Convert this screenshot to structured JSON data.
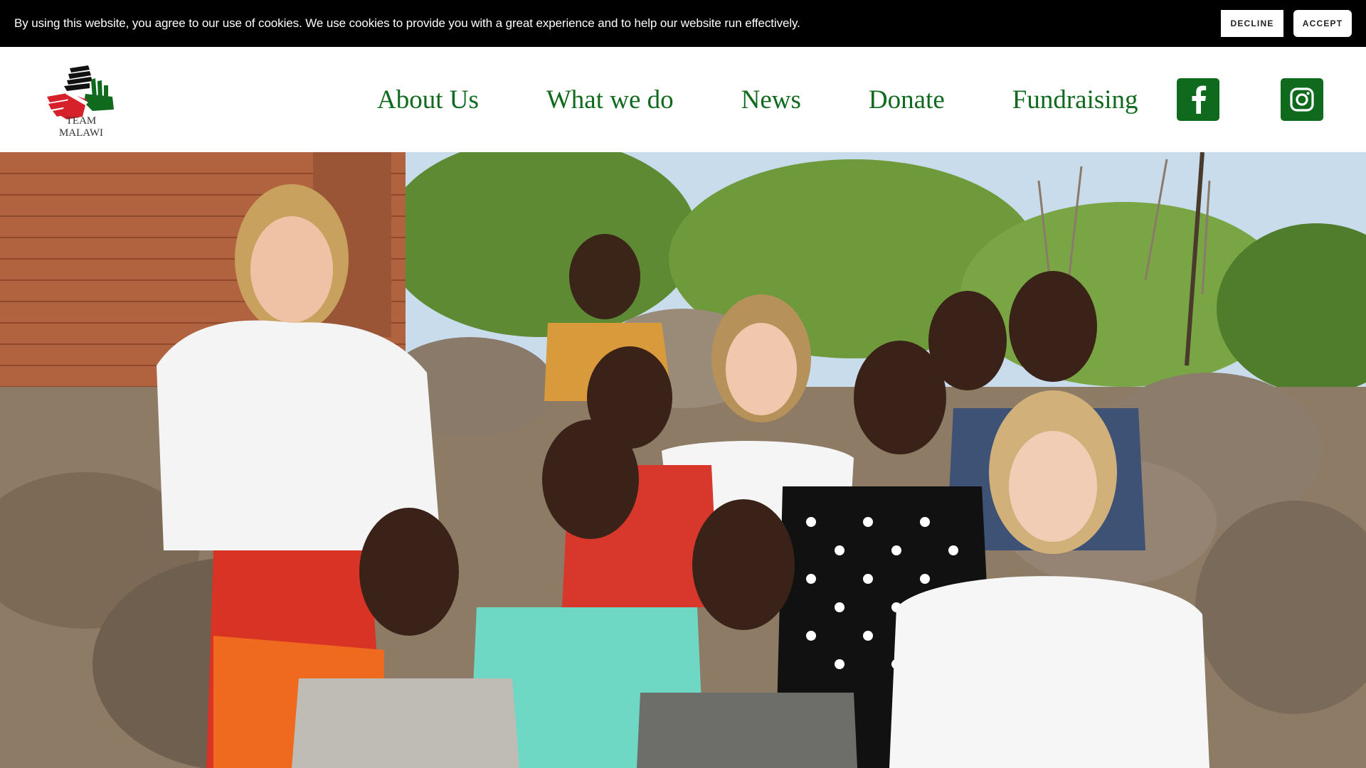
{
  "cookie_banner": {
    "text": "By using this website, you agree to our use of cookies. We use cookies to provide you with a great experience and to help our website run effectively.",
    "decline_label": "Decline",
    "accept_label": "Accept"
  },
  "brand": {
    "name": "TEAM MALAWI",
    "colors": {
      "green": "#0f6a1d",
      "red": "#d6202a",
      "black": "#111111"
    }
  },
  "nav": {
    "items": [
      {
        "label": "About Us"
      },
      {
        "label": "What we do"
      },
      {
        "label": "News"
      },
      {
        "label": "Donate"
      },
      {
        "label": "Fundraising"
      }
    ]
  },
  "social": {
    "facebook_icon": "facebook-icon",
    "instagram_icon": "instagram-icon"
  },
  "hero": {
    "image_description": "photo"
  }
}
